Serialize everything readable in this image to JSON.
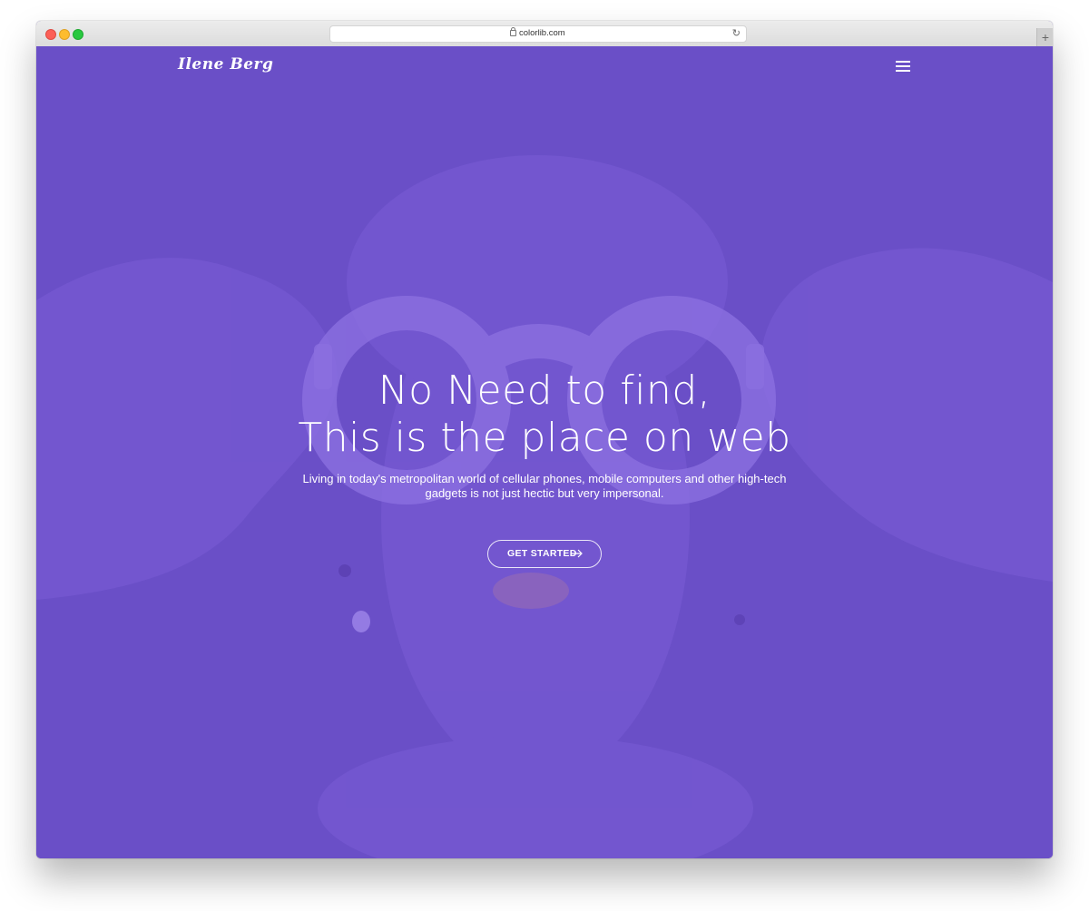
{
  "browser": {
    "url": "colorlib.com"
  },
  "site": {
    "brand": "Ilene Berg",
    "accent_color": "#6a4fc7",
    "icons": [
      "menu-icon",
      "arrow-right-icon",
      "lock-icon",
      "reload-icon"
    ]
  },
  "hero": {
    "headline_line1": "No Need to find,",
    "headline_line2": "This is the place on web",
    "subtext": "Living in today's metropolitan world of cellular phones, mobile computers and other high-tech gadgets is not just hectic but very impersonal.",
    "cta_label": "GET STARTED"
  }
}
